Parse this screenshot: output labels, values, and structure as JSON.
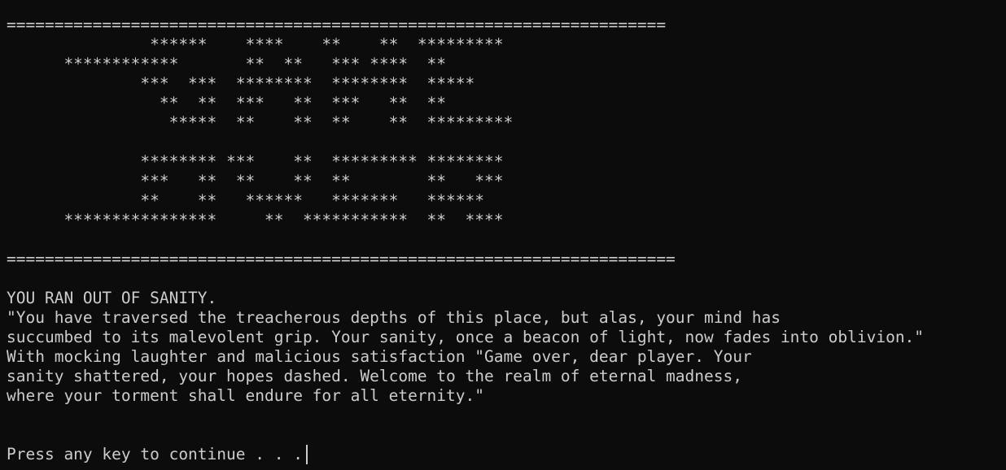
{
  "terminal": {
    "banner_lines": [
      "=====================================================================",
      "               ******    ****    **    **  *********",
      "      ************       **  **   *** ****  **",
      "              ***  ***  ********  ********  *****",
      "                **  **  ***   **  ***   **  **",
      "                 *****  **    **  **    **  *********",
      "",
      "              ******** ***    **  ********* ********",
      "              ***   **  **    **  **        **   ***",
      "              **    **   ******   *******   ******",
      "      ****************     **  ***********  **  ****",
      "",
      "======================================================================"
    ],
    "message_lines": [
      "YOU RAN OUT OF SANITY.",
      "\"You have traversed the treacherous depths of this place, but alas, your mind has",
      "succumbed to its malevolent grip. Your sanity, once a beacon of light, now fades into oblivion.\"",
      "With mocking laughter and malicious satisfaction \"Game over, dear player. Your",
      "sanity shattered, your hopes dashed. Welcome to the realm of eternal madness,",
      "where your torment shall endure for all eternity.\""
    ],
    "prompt": "Press any key to continue . . ."
  },
  "colors": {
    "background": "#0c0c0c",
    "foreground": "#cccccc"
  }
}
